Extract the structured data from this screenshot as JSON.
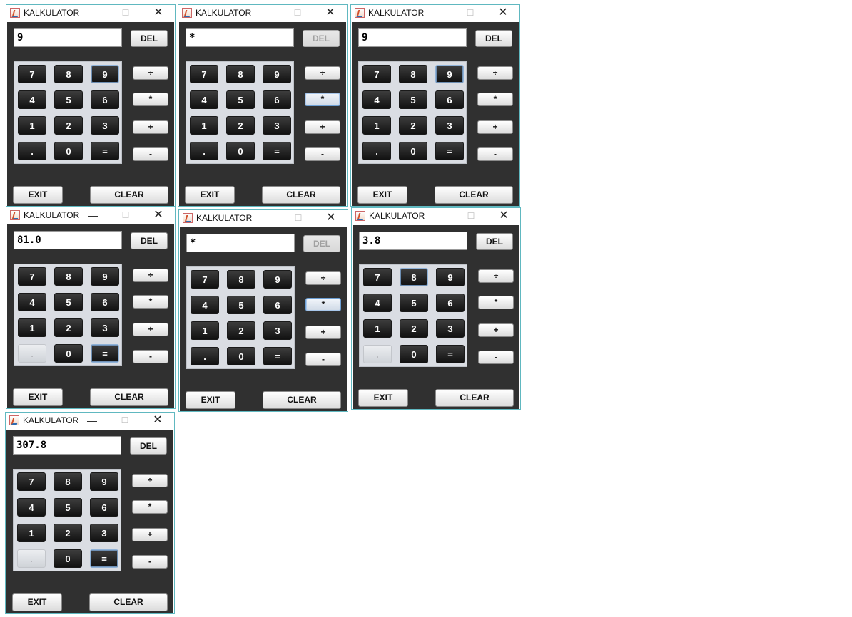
{
  "app": {
    "title": "KALKULATOR",
    "min_icon": "—",
    "max_icon": "☐",
    "close_icon": "✕"
  },
  "keys": [
    [
      "7",
      "8",
      "9"
    ],
    [
      "4",
      "5",
      "6"
    ],
    [
      "1",
      "2",
      "3"
    ],
    [
      ".",
      "0",
      "="
    ]
  ],
  "ops": [
    "÷",
    "*",
    "+",
    "-"
  ],
  "labels": {
    "del": "DEL",
    "exit": "EXIT",
    "clear": "CLEAR"
  },
  "windows": [
    {
      "display": "9",
      "del_disabled": false,
      "pressed_key": "9",
      "pressed_op": null,
      "dot_disabled": false
    },
    {
      "display": "*",
      "del_disabled": true,
      "pressed_key": null,
      "pressed_op": "*",
      "dot_disabled": false
    },
    {
      "display": "9",
      "del_disabled": false,
      "pressed_key": "9",
      "pressed_op": null,
      "dot_disabled": false
    },
    {
      "display": "81.0",
      "del_disabled": false,
      "pressed_key": "=",
      "pressed_op": null,
      "dot_disabled": true
    },
    {
      "display": "*",
      "del_disabled": true,
      "pressed_key": null,
      "pressed_op": "*",
      "dot_disabled": false
    },
    {
      "display": "3.8",
      "del_disabled": false,
      "pressed_key": "8",
      "pressed_op": null,
      "dot_disabled": true
    },
    {
      "display": "307.8",
      "del_disabled": false,
      "pressed_key": "=",
      "pressed_op": null,
      "dot_disabled": true
    }
  ]
}
